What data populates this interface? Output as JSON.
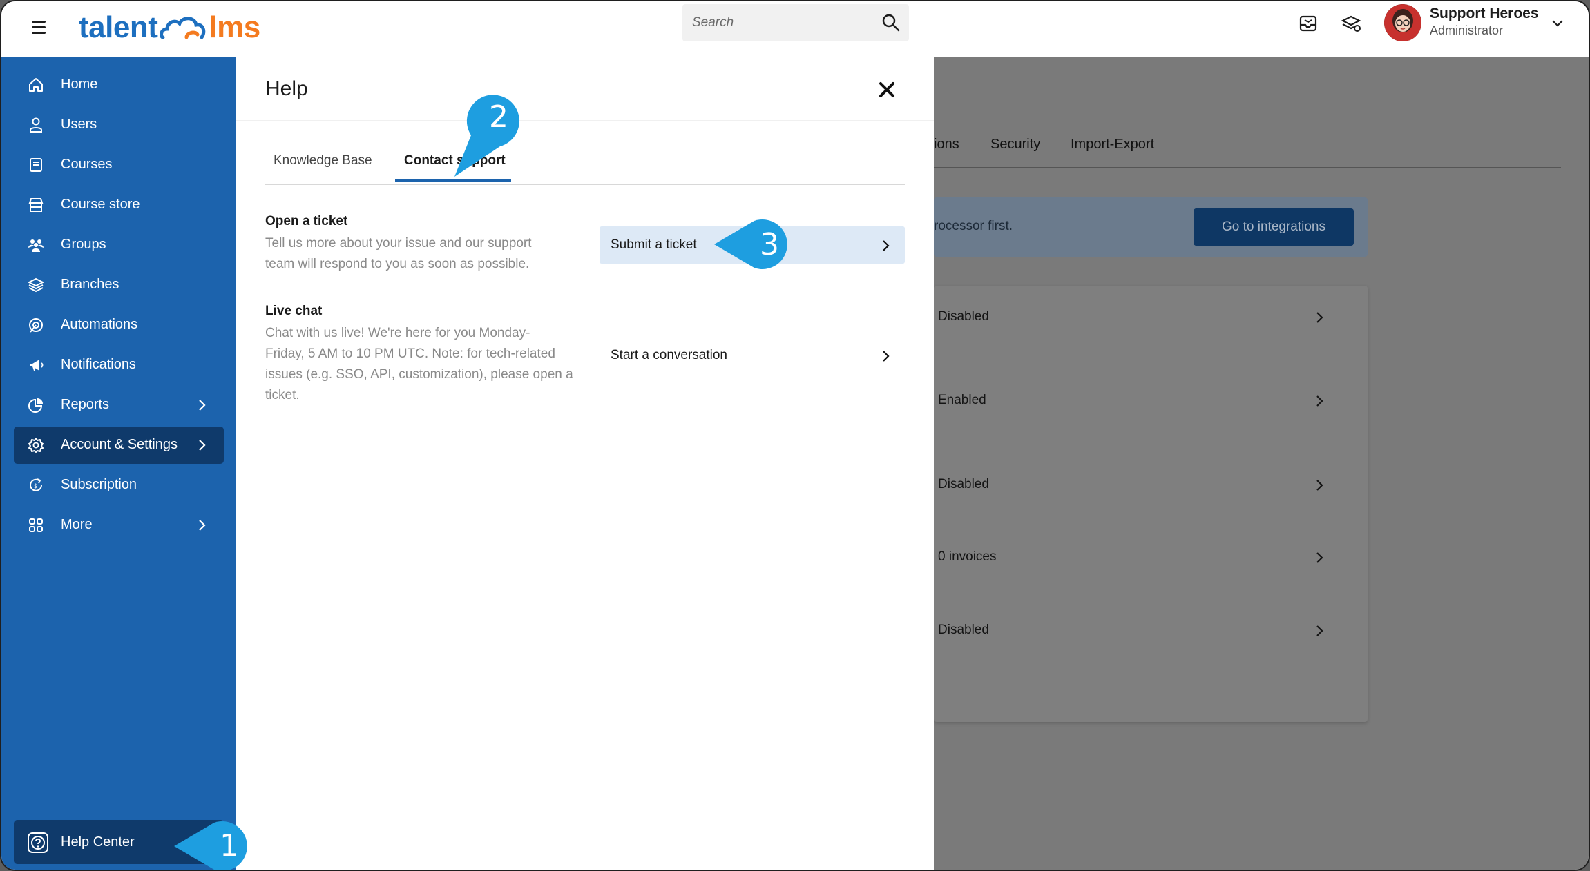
{
  "header": {
    "logo_left": "talent",
    "logo_right": "lms",
    "search_placeholder": "Search",
    "user_name": "Support Heroes",
    "user_role": "Administrator"
  },
  "sidebar": {
    "items": [
      {
        "label": "Home",
        "icon": "home-icon"
      },
      {
        "label": "Users",
        "icon": "user-icon"
      },
      {
        "label": "Courses",
        "icon": "book-icon"
      },
      {
        "label": "Course store",
        "icon": "store-icon"
      },
      {
        "label": "Groups",
        "icon": "groups-icon"
      },
      {
        "label": "Branches",
        "icon": "layers-icon"
      },
      {
        "label": "Automations",
        "icon": "automation-icon"
      },
      {
        "label": "Notifications",
        "icon": "megaphone-icon"
      },
      {
        "label": "Reports",
        "icon": "pie-chart-icon"
      },
      {
        "label": "Account & Settings",
        "icon": "gear-icon"
      },
      {
        "label": "Subscription",
        "icon": "subscription-icon"
      },
      {
        "label": "More",
        "icon": "grid-icon"
      }
    ],
    "help_center": "Help Center"
  },
  "background": {
    "tabs": [
      "ions",
      "Security",
      "Import-Export"
    ],
    "banner_text": "rocessor first.",
    "banner_button": "Go to integrations",
    "rows": [
      "Disabled",
      "Enabled",
      "Disabled",
      "0 invoices",
      "Disabled"
    ]
  },
  "help_panel": {
    "title": "Help",
    "tabs": [
      "Knowledge Base",
      "Contact support"
    ],
    "active_tab": "Contact support",
    "sections": [
      {
        "title": "Open a ticket",
        "description_lines": [
          "Tell us more about your issue and our support",
          "team will respond to you as soon as possible."
        ],
        "action": "Submit a ticket"
      },
      {
        "title": "Live chat",
        "description_lines": [
          "Chat with us live! We're here for you Monday-",
          "Friday, 5 AM to 10 PM UTC. Note: for tech-related",
          "issues (e.g. SSO, API, customization), please open a",
          "ticket."
        ],
        "action": "Start a conversation"
      }
    ]
  },
  "callouts": [
    "1",
    "2",
    "3"
  ],
  "colors": {
    "sidebar": "#1c63ad",
    "sidebar_active": "#0f3a6b",
    "callout": "#1e9ee0",
    "logo_blue": "#1d6fbf",
    "logo_orange": "#f47b20",
    "highlight": "#dde9f6"
  }
}
